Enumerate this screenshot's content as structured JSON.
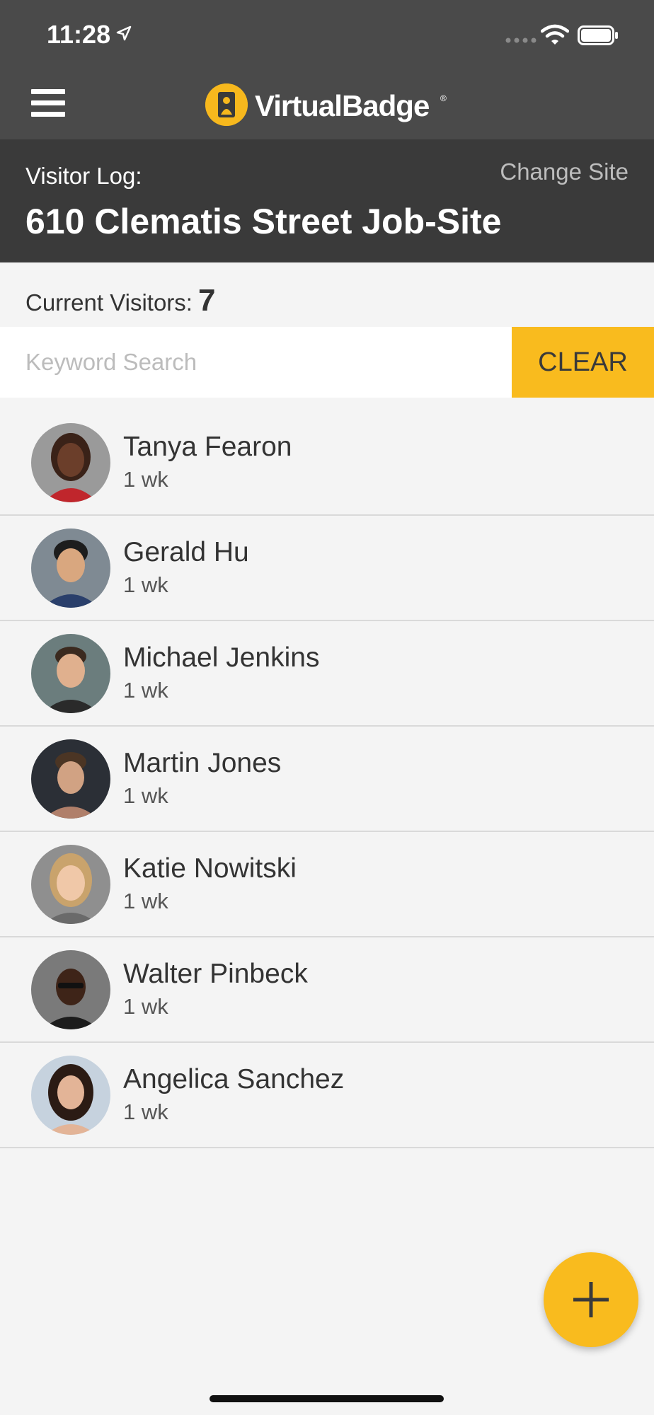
{
  "status_bar": {
    "time": "11:28",
    "location_icon": "location-arrow-icon",
    "signal_icon": "signal-dots-icon",
    "wifi_icon": "wifi-icon",
    "battery_icon": "battery-icon"
  },
  "header": {
    "menu_icon": "hamburger-menu-icon",
    "logo_text": "VirtualBadge",
    "logo_mark": "®",
    "background": "#4a4a4a"
  },
  "site": {
    "label": "Visitor Log:",
    "name": "610 Clematis Street Job-Site",
    "change_label": "Change Site",
    "background": "#3a3a3a"
  },
  "visitors": {
    "count_label": "Current Visitors:",
    "count": "7"
  },
  "search": {
    "placeholder": "Keyword Search",
    "value": "",
    "clear_label": "CLEAR"
  },
  "visitor_list": [
    {
      "name": "Tanya Fearon",
      "time": "1 wk"
    },
    {
      "name": "Gerald Hu",
      "time": "1 wk"
    },
    {
      "name": "Michael Jenkins",
      "time": "1 wk"
    },
    {
      "name": "Martin Jones",
      "time": "1 wk"
    },
    {
      "name": "Katie Nowitski",
      "time": "1 wk"
    },
    {
      "name": "Walter Pinbeck",
      "time": "1 wk"
    },
    {
      "name": "Angelica Sanchez",
      "time": "1 wk"
    }
  ],
  "fab": {
    "icon": "plus-icon"
  },
  "colors": {
    "accent": "#f9bb1e",
    "list_background": "#f4f4f4",
    "divider": "#d9d9d9"
  }
}
